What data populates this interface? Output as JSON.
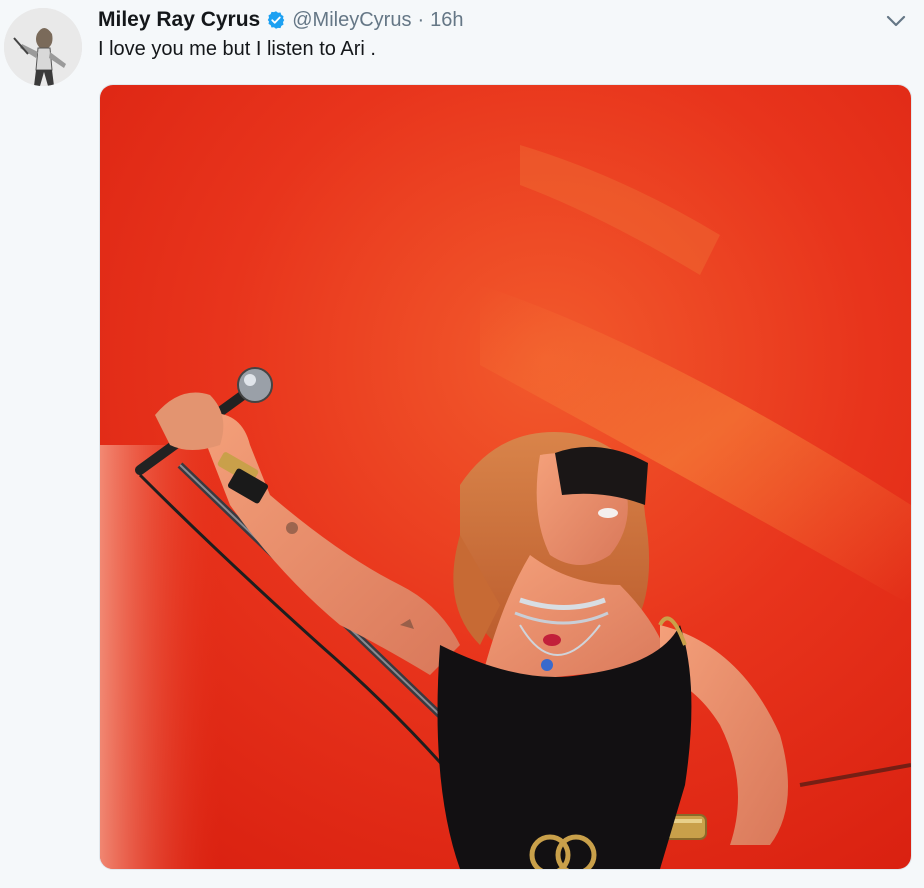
{
  "tweet": {
    "display_name": "Miley Ray Cyrus",
    "handle": "@MileyCyrus",
    "separator": "·",
    "time": "16h",
    "text": "I love you me but I listen to Ari .",
    "verified": true
  },
  "icons": {
    "verified": "verified-badge-icon",
    "menu": "chevron-down-icon"
  },
  "colors": {
    "name": "#14171a",
    "secondary": "#657786",
    "verified": "#1da1f2",
    "background": "#f5f8fa",
    "stage_red": "#e8341c"
  }
}
